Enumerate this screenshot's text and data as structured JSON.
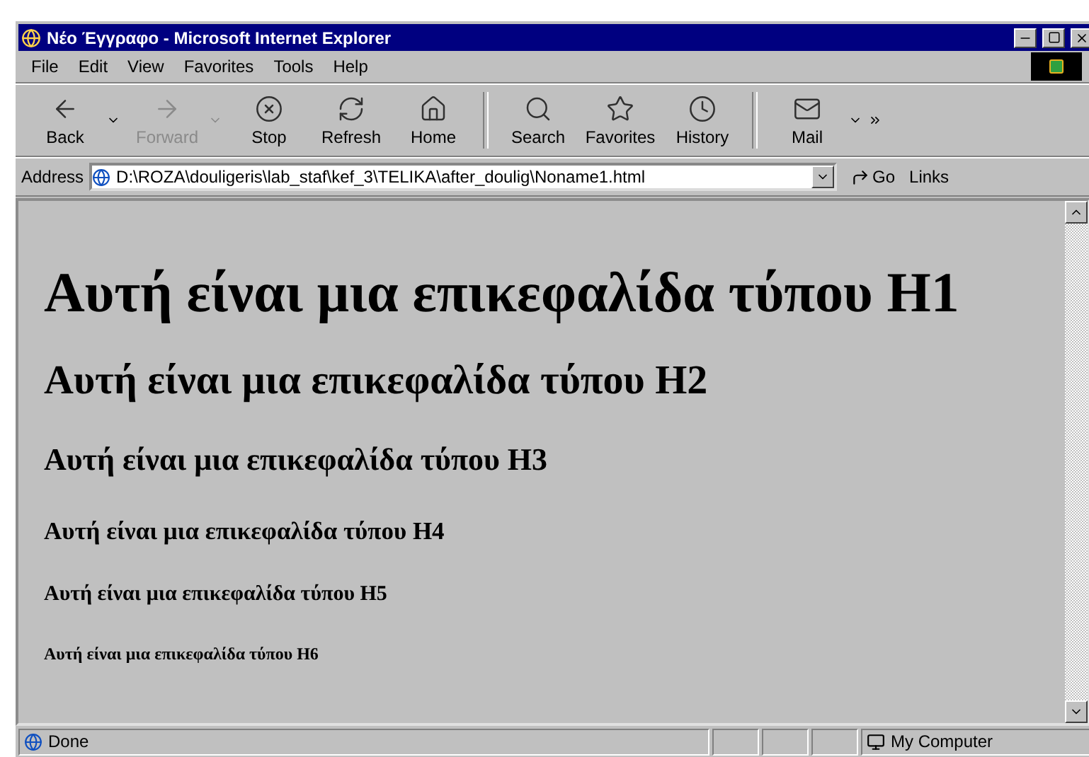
{
  "window": {
    "title": "Νέο Έγγραφο - Microsoft Internet Explorer"
  },
  "menu": [
    "File",
    "Edit",
    "View",
    "Favorites",
    "Tools",
    "Help"
  ],
  "toolbar": [
    {
      "kind": "button",
      "label": "Back",
      "disabled": false,
      "dropdown": true
    },
    {
      "kind": "button",
      "label": "Forward",
      "disabled": true,
      "dropdown": true
    },
    {
      "kind": "button",
      "label": "Stop",
      "disabled": false,
      "dropdown": false
    },
    {
      "kind": "button",
      "label": "Refresh",
      "disabled": false,
      "dropdown": false
    },
    {
      "kind": "button",
      "label": "Home",
      "disabled": false,
      "dropdown": false
    },
    {
      "kind": "separator"
    },
    {
      "kind": "button",
      "label": "Search",
      "disabled": false,
      "dropdown": false
    },
    {
      "kind": "button",
      "label": "Favorites",
      "disabled": false,
      "dropdown": false
    },
    {
      "kind": "button",
      "label": "History",
      "disabled": false,
      "dropdown": false
    },
    {
      "kind": "separator"
    },
    {
      "kind": "button",
      "label": "Mail",
      "disabled": false,
      "dropdown": true
    }
  ],
  "address": {
    "label": "Address",
    "value": "D:\\ROZA\\douligeris\\lab_staf\\kef_3\\TELIKA\\after_doulig\\Noname1.html",
    "go": "Go",
    "links": "Links"
  },
  "headings": [
    "Αυτή είναι μια επικεφαλίδα τύπου Η1",
    "Αυτή είναι μια επικεφαλίδα τύπου Η2",
    "Αυτή είναι μια επικεφαλίδα τύπου Η3",
    "Αυτή είναι μια επικεφαλίδα τύπου Η4",
    "Αυτή είναι μια επικεφαλίδα τύπου Η5",
    "Αυτή είναι μια επικεφαλίδα τύπου Η6"
  ],
  "status_bar": {
    "status": "Done",
    "zone": "My Computer"
  }
}
